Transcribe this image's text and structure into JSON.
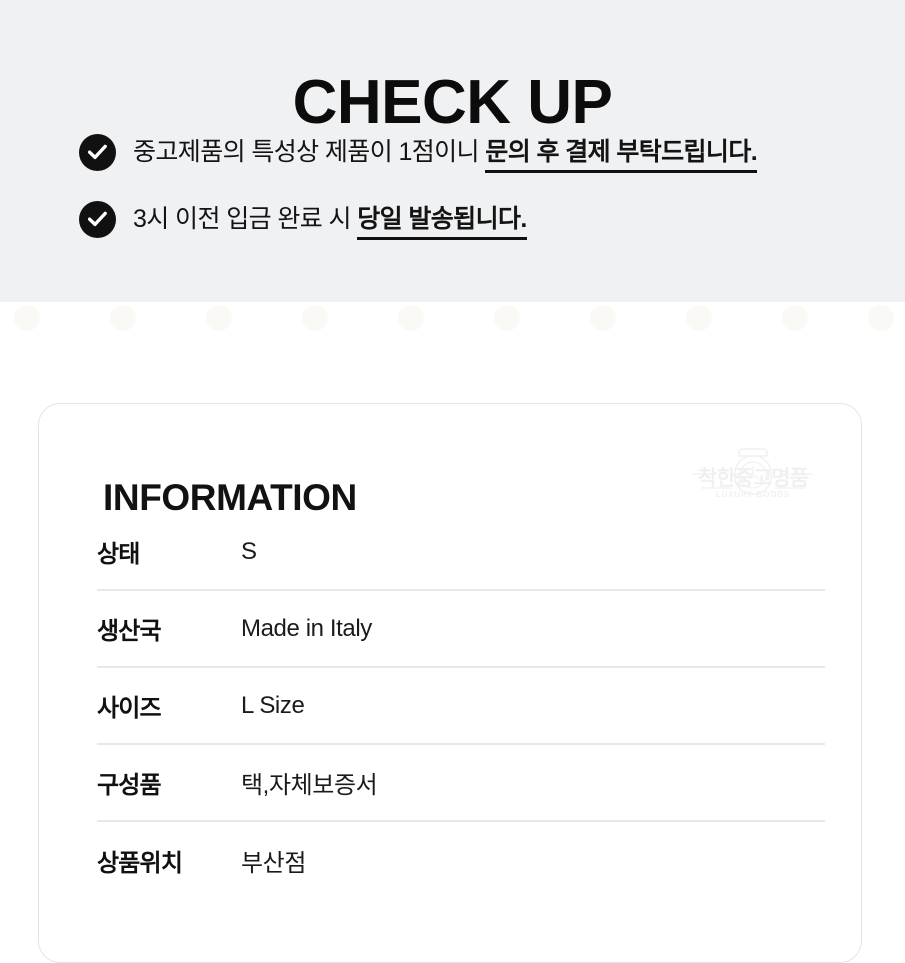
{
  "checkup": {
    "title": "CHECK UP",
    "background_color": "#F0F1F3",
    "icon_name": "check-circle-icon",
    "items": [
      {
        "text_normal": "중고제품의 특성상 제품이 1점이니 ",
        "text_emphasis": "문의 후 결제 부탁드립니다."
      },
      {
        "text_normal": "3시 이전 입금 완료 시 ",
        "text_emphasis": "당일 발송됩니다."
      }
    ]
  },
  "information": {
    "heading": "INFORMATION",
    "watermark": {
      "icon_name": "watch-outline-icon",
      "brand_ko": "착한중고명품",
      "brand_en": "LUXURY GOODS"
    },
    "rows": [
      {
        "label": "상태",
        "value": "S"
      },
      {
        "label": "생산국",
        "value": "Made in Italy"
      },
      {
        "label": "사이즈",
        "value": "L Size"
      },
      {
        "label": "구성품",
        "value": "택,자체보증서"
      },
      {
        "label": "상품위치",
        "value": "부산점"
      }
    ]
  },
  "colors": {
    "band": "#F0F1F3",
    "ink": "#111111",
    "divider": "#E7E8EA",
    "card_border": "#E3E4E6"
  }
}
